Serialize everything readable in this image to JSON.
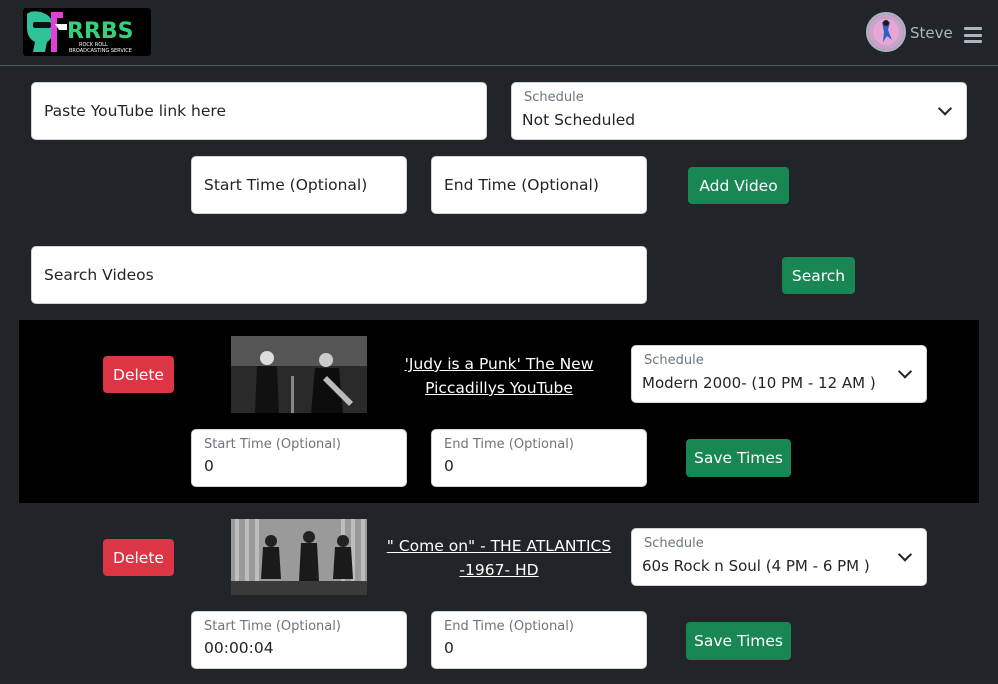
{
  "header": {
    "logo_text": "RRBS",
    "logo_sub": "ROCK 'N ROLL BROADCASTING SERVICE",
    "username": "Steve"
  },
  "add_form": {
    "link_placeholder": "Paste YouTube link here",
    "schedule_label": "Schedule",
    "schedule_value": "Not Scheduled",
    "start_placeholder": "Start Time (Optional)",
    "end_placeholder": "End Time (Optional)",
    "add_label": "Add Video"
  },
  "search": {
    "placeholder": "Search Videos",
    "button_label": "Search"
  },
  "videos": [
    {
      "delete_label": "Delete",
      "title_line1": "'Judy is a Punk' The New",
      "title_line2": "Piccadillys YouTube",
      "schedule_label": "Schedule",
      "schedule_value": "Modern 2000- (10 PM - 12 AM )",
      "start_label": "Start Time (Optional)",
      "start_value": "0",
      "end_label": "End Time (Optional)",
      "end_value": "0",
      "save_label": "Save Times"
    },
    {
      "delete_label": "Delete",
      "title_line1": "\" Come on\" - THE ATLANTICS",
      "title_line2": "-1967- HD",
      "schedule_label": "Schedule",
      "schedule_value": "60s Rock n Soul (4 PM - 6 PM )",
      "start_label": "Start Time (Optional)",
      "start_value": "00:00:04",
      "end_label": "End Time (Optional)",
      "end_value": "0",
      "save_label": "Save Times"
    }
  ],
  "colors": {
    "background": "#212529",
    "primary_green": "#198754",
    "danger_red": "#dc3545"
  }
}
